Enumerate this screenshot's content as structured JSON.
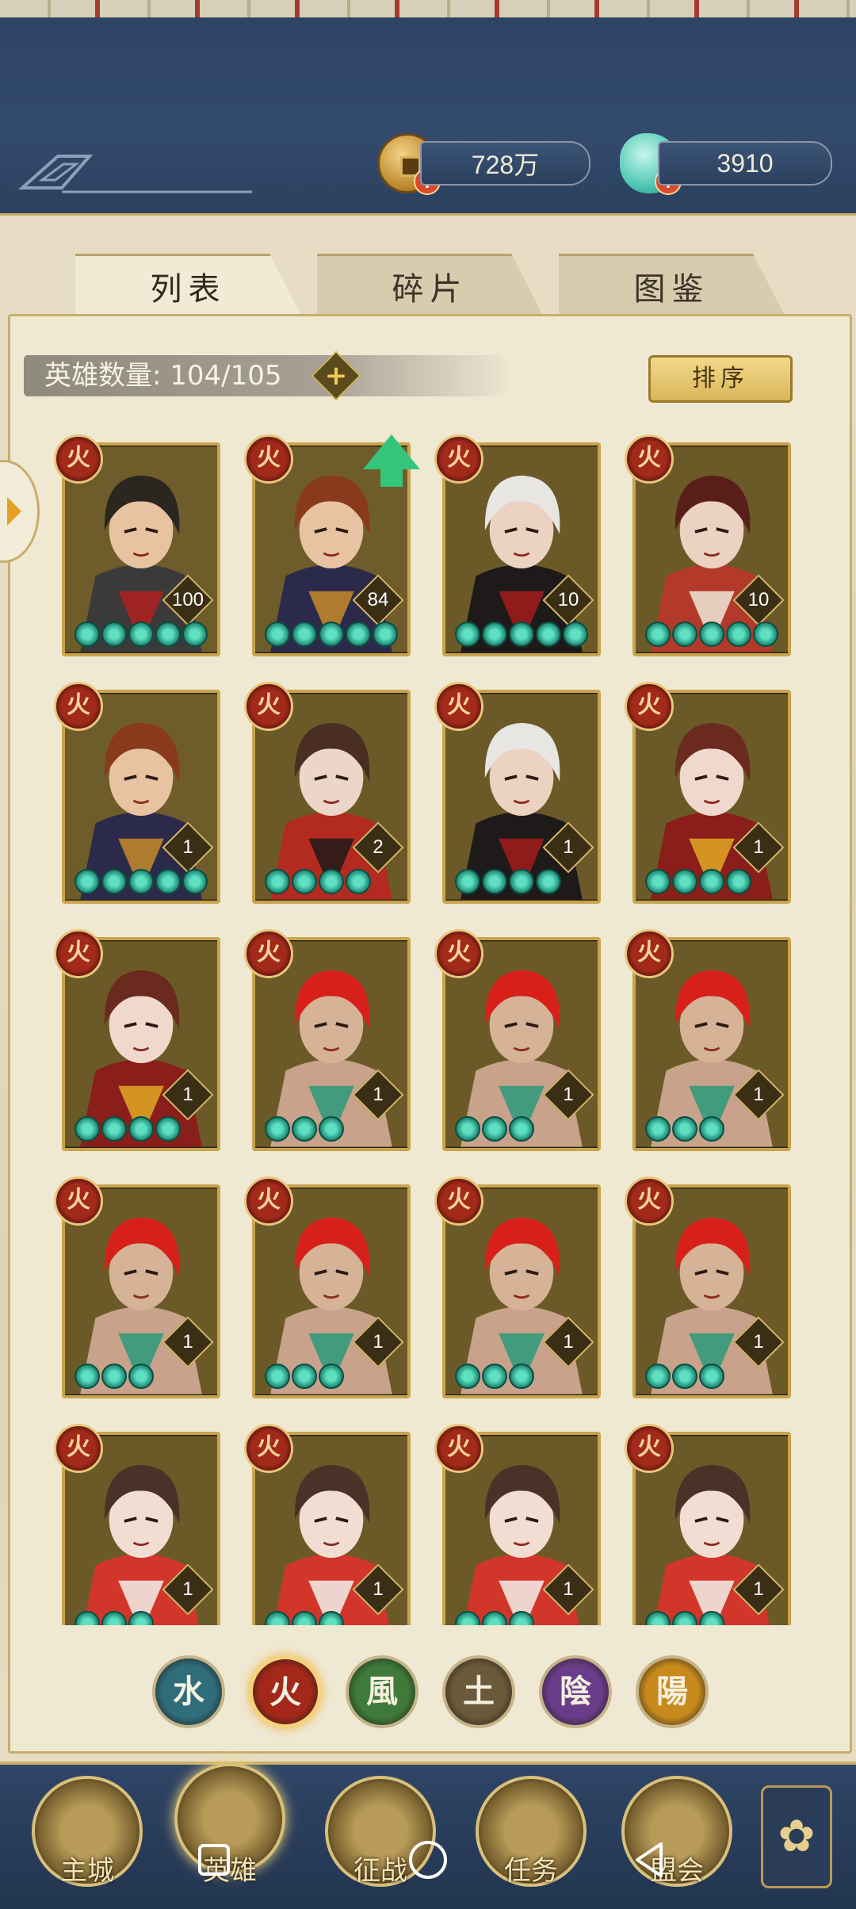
{
  "currency": {
    "coins": "728万",
    "jade": "3910"
  },
  "tabs": [
    "列表",
    "碎片",
    "图鉴"
  ],
  "hero_count_label": "英雄数量: 104/105",
  "sort_label": "排序",
  "element_glyph": "火",
  "heroes": [
    {
      "level": "100",
      "stars": 5,
      "art": "straw-hat-warrior"
    },
    {
      "level": "84",
      "stars": 5,
      "art": "dark-armor-swordsman",
      "upgrade": true
    },
    {
      "level": "10",
      "stars": 5,
      "art": "white-hair-sorcerer"
    },
    {
      "level": "10",
      "stars": 5,
      "art": "veiled-hat-lady"
    },
    {
      "level": "1",
      "stars": 5,
      "art": "dark-armor-swordsman"
    },
    {
      "level": "2",
      "stars": 4,
      "art": "red-robe-lady"
    },
    {
      "level": "1",
      "stars": 4,
      "art": "white-hair-sorcerer"
    },
    {
      "level": "1",
      "stars": 4,
      "art": "flame-dancer"
    },
    {
      "level": "1",
      "stars": 4,
      "art": "flame-dancer"
    },
    {
      "level": "1",
      "stars": 3,
      "art": "red-hair-demon"
    },
    {
      "level": "1",
      "stars": 3,
      "art": "red-hair-demon"
    },
    {
      "level": "1",
      "stars": 3,
      "art": "red-hair-demon"
    },
    {
      "level": "1",
      "stars": 3,
      "art": "red-hair-demon"
    },
    {
      "level": "1",
      "stars": 3,
      "art": "red-hair-demon"
    },
    {
      "level": "1",
      "stars": 3,
      "art": "red-hair-demon"
    },
    {
      "level": "1",
      "stars": 3,
      "art": "red-hair-demon"
    },
    {
      "level": "1",
      "stars": 3,
      "art": "twin-bun-girl"
    },
    {
      "level": "1",
      "stars": 3,
      "art": "twin-bun-girl"
    },
    {
      "level": "1",
      "stars": 3,
      "art": "twin-bun-girl"
    },
    {
      "level": "1",
      "stars": 3,
      "art": "twin-bun-girl"
    }
  ],
  "element_filters": [
    {
      "glyph": "水",
      "color": "#2f6d7a",
      "selected": false
    },
    {
      "glyph": "火",
      "color": "#a3281a",
      "selected": true
    },
    {
      "glyph": "風",
      "color": "#3f7a3a",
      "selected": false
    },
    {
      "glyph": "土",
      "color": "#6b5a3a",
      "selected": false
    },
    {
      "glyph": "陰",
      "color": "#6a3d8a",
      "selected": false
    },
    {
      "glyph": "陽",
      "color": "#c88a1c",
      "selected": false
    }
  ],
  "nav": [
    "主城",
    "英雄",
    "征战",
    "任务",
    "盟会"
  ]
}
